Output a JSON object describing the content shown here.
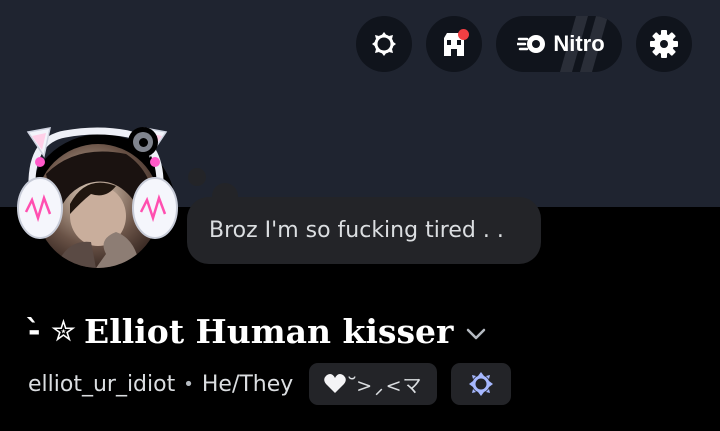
{
  "header": {
    "nitro_label": "Nitro",
    "buttons": [
      {
        "icon": "boost-icon"
      },
      {
        "icon": "shop-icon",
        "has_notification": true
      },
      {
        "icon": "nitro-icon"
      },
      {
        "icon": "gear-icon"
      }
    ]
  },
  "profile": {
    "custom_status": "Broz I'm so fucking tired . .",
    "name_prefix": "-̀ ✮",
    "display_name": "Elliot Human kisser",
    "username": "elliot_ur_idiot",
    "separator": "•",
    "pronouns": "He/They",
    "tag_text": "᳴>⸝<マ",
    "status": "idle-offline"
  },
  "colors": {
    "banner": "#1f2430",
    "background": "#000000",
    "pill": "#232428",
    "notification": "#f23f43",
    "badge_blue": "#a6b8ff"
  }
}
